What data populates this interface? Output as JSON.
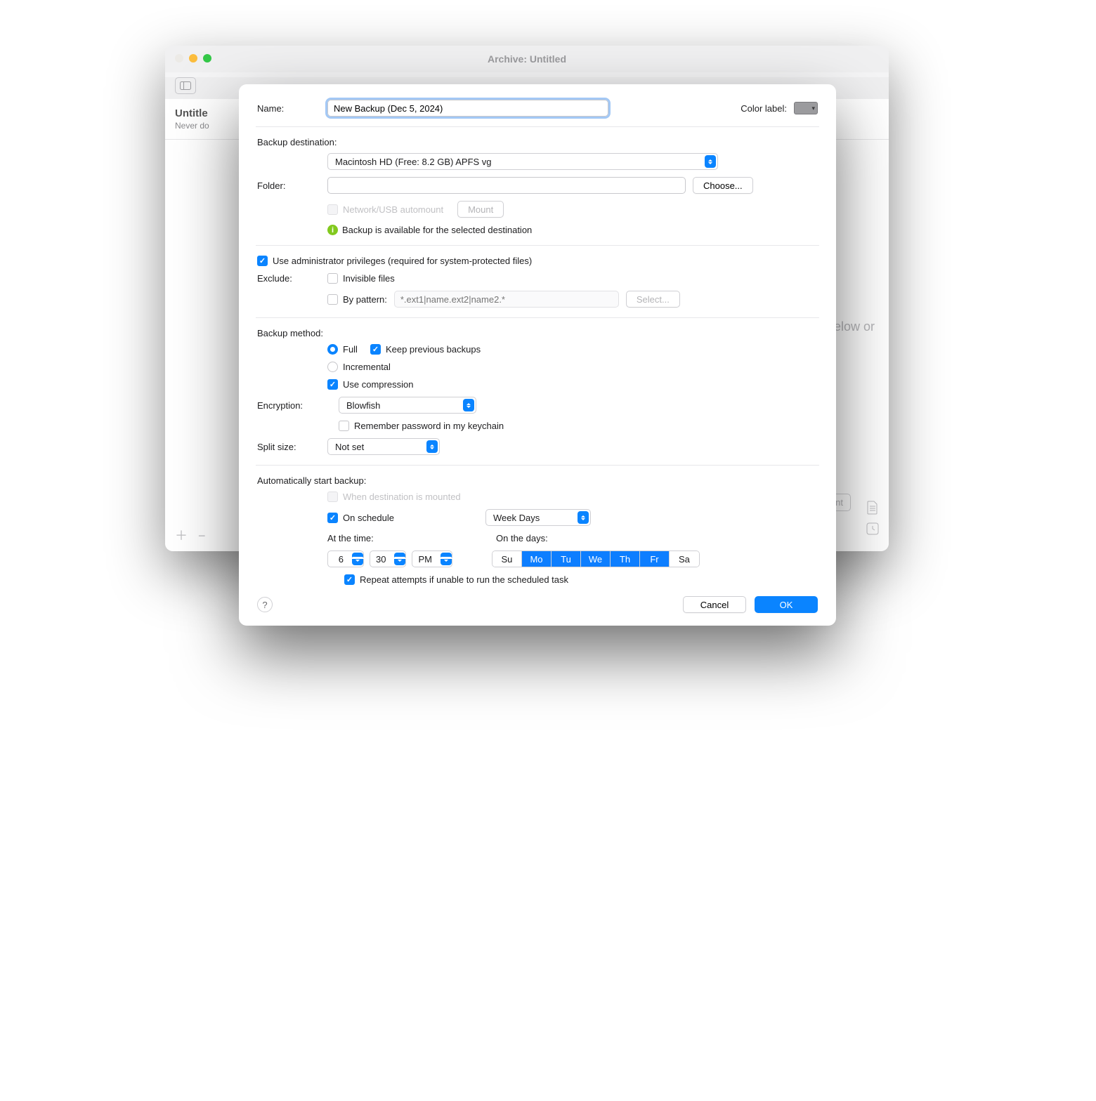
{
  "window": {
    "title": "Archive: Untitled",
    "sidebar": {
      "title": "Untitle",
      "subtitle": "Never do"
    },
    "bg_hint": "elow or",
    "bg_btn": "tent",
    "plus": "＋",
    "minus": "−"
  },
  "labels": {
    "name": "Name:",
    "color_label": "Color label:",
    "backup_destination": "Backup destination:",
    "folder": "Folder:",
    "exclude": "Exclude:",
    "backup_method": "Backup method:",
    "encryption": "Encryption:",
    "split_size": "Split size:",
    "auto_start": "Automatically start backup:",
    "at_the_time": "At the time:",
    "on_the_days": "On the days:"
  },
  "name_value": "New Backup (Dec 5, 2024)",
  "destination": {
    "selected": "Macintosh HD (Free: 8.2 GB) APFS vg"
  },
  "folder_value": "",
  "choose": "Choose...",
  "automount": "Network/USB automount",
  "mount": "Mount",
  "dest_status": "Backup is available for the selected destination",
  "admin_priv": "Use administrator privileges (required for system-protected files)",
  "invisible_files": "Invisible files",
  "by_pattern": "By pattern:",
  "pattern_placeholder": "*.ext1|name.ext2|name2.*",
  "select_btn": "Select...",
  "full": "Full",
  "keep_prev": "Keep previous backups",
  "incremental": "Incremental",
  "use_compression": "Use compression",
  "encryption": {
    "selected": "Blowfish"
  },
  "remember_pw": "Remember password in my keychain",
  "split_size": {
    "selected": "Not set"
  },
  "when_mounted": "When destination is mounted",
  "on_schedule": "On schedule",
  "schedule_mode": {
    "selected": "Week Days"
  },
  "time": {
    "hour": "6",
    "minute": "30",
    "ampm": "PM"
  },
  "days": [
    "Su",
    "Mo",
    "Tu",
    "We",
    "Th",
    "Fr",
    "Sa"
  ],
  "days_on": [
    false,
    true,
    true,
    true,
    true,
    true,
    false
  ],
  "repeat": "Repeat attempts if unable to run the scheduled task",
  "cancel": "Cancel",
  "ok": "OK",
  "help": "?"
}
